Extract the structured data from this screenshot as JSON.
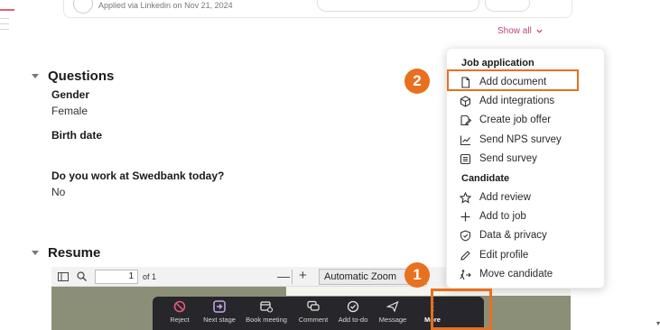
{
  "applied_text": "Applied via Linkedin on Nov 21, 2024",
  "show_all": {
    "label": "Show all",
    "icon": "chevron-down-icon"
  },
  "questions": {
    "title": "Questions",
    "items": [
      {
        "label": "Gender",
        "value": "Female"
      },
      {
        "label": "Birth date",
        "value": ""
      },
      {
        "label": "Do you work at Swedbank today?",
        "value": "No"
      }
    ]
  },
  "resume": {
    "title": "Resume",
    "pdf_toolbar": {
      "page_value": "1",
      "page_of": "of 1",
      "zoom_minus": "—",
      "zoom_plus": "+",
      "zoom_value": "Automatic Zoom"
    }
  },
  "action_bar": {
    "actions": [
      {
        "label": "Reject",
        "icon": "block-icon"
      },
      {
        "label": "Next stage",
        "icon": "next-stage-icon"
      },
      {
        "label": "Book meeting",
        "icon": "calendar-icon"
      },
      {
        "label": "Comment",
        "icon": "comment-icon"
      },
      {
        "label": "Add to-do",
        "icon": "check-circle-icon"
      },
      {
        "label": "Message",
        "icon": "send-icon"
      },
      {
        "label": "More",
        "icon": "more-vertical-icon"
      }
    ]
  },
  "dropdown": {
    "job_application": {
      "title": "Job application",
      "items": [
        {
          "label": "Add document",
          "icon": "document-icon"
        },
        {
          "label": "Add integrations",
          "icon": "integrations-icon"
        },
        {
          "label": "Create job offer",
          "icon": "job-offer-icon"
        },
        {
          "label": "Send NPS survey",
          "icon": "chart-icon"
        },
        {
          "label": "Send survey",
          "icon": "survey-icon"
        }
      ]
    },
    "candidate": {
      "title": "Candidate",
      "items": [
        {
          "label": "Add review",
          "icon": "star-icon"
        },
        {
          "label": "Add to job",
          "icon": "plus-icon"
        },
        {
          "label": "Data & privacy",
          "icon": "shield-icon"
        },
        {
          "label": "Edit profile",
          "icon": "pencil-icon"
        },
        {
          "label": "Move candidate",
          "icon": "move-icon"
        }
      ]
    }
  },
  "annotations": {
    "badge_1": "1",
    "badge_2": "2",
    "highlight_color": "#e8701e"
  },
  "colors": {
    "accent": "#c2417a",
    "action_bar_bg": "#26262b",
    "highlight": "#e8701e"
  }
}
